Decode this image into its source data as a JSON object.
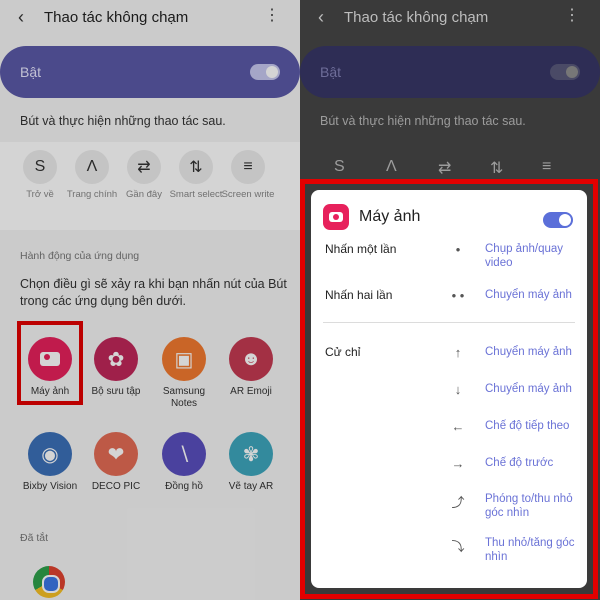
{
  "header": {
    "back_icon": "arrow-left-icon",
    "title": "Thao tác không chạm",
    "more_icon": "more-vert-icon"
  },
  "master_toggle": {
    "label": "Bật",
    "on": true
  },
  "instruction": "Bút và thực hiện những thao tác sau.",
  "gestures": [
    {
      "label": "Trở về",
      "icon": "gesture-back-icon"
    },
    {
      "label": "Trang chính",
      "icon": "gesture-home-icon"
    },
    {
      "label": "Gần đây",
      "icon": "gesture-recent-icon"
    },
    {
      "label": "Smart select",
      "icon": "gesture-smart-select-icon"
    },
    {
      "label": "Screen write",
      "icon": "gesture-screen-write-icon"
    }
  ],
  "app_actions": {
    "section_title": "Hành động của ứng dụng",
    "description": "Chọn điều gì sẽ xảy ra khi bạn nhấn nút của Bút trong các ứng dụng bên dưới.",
    "apps": [
      {
        "name": "Máy ảnh",
        "icon": "camera-icon",
        "color": "#e7215c"
      },
      {
        "name": "Bộ sưu tập",
        "icon": "gallery-icon",
        "color": "#c0275a"
      },
      {
        "name": "Samsung Notes",
        "icon": "notes-icon",
        "color": "#f27a2f"
      },
      {
        "name": "AR Emoji",
        "icon": "ar-emoji-icon",
        "color": "#c53a52"
      },
      {
        "name": "Bixby Vision",
        "icon": "bixby-vision-icon",
        "color": "#3c70b8"
      },
      {
        "name": "DECO PIC",
        "icon": "deco-pic-icon",
        "color": "#e46b55"
      },
      {
        "name": "Đồng hồ",
        "icon": "clock-icon",
        "color": "#5a4fbe"
      },
      {
        "name": "Vẽ tay AR",
        "icon": "ar-doodle-icon",
        "color": "#3ea6bd"
      }
    ],
    "disabled_section_title": "Đã tắt",
    "disabled_apps": [
      {
        "name": "Chrome",
        "icon": "chrome-icon"
      }
    ]
  },
  "camera_dialog": {
    "title": "Máy ảnh",
    "enabled": true,
    "press_actions": [
      {
        "trigger": "Nhấn một lần",
        "gesture": "•",
        "action": "Chụp ảnh/quay video"
      },
      {
        "trigger": "Nhấn hai lần",
        "gesture": "• •",
        "action": "Chuyển máy ảnh"
      }
    ],
    "gesture_label": "Cử chỉ",
    "gesture_actions": [
      {
        "gesture": "↑",
        "icon": "arrow-up-icon",
        "action": "Chuyển máy ảnh"
      },
      {
        "gesture": "↓",
        "icon": "arrow-down-icon",
        "action": "Chuyển máy ảnh"
      },
      {
        "gesture": "←",
        "icon": "arrow-left-icon",
        "action": "Chế độ tiếp theo"
      },
      {
        "gesture": "→",
        "icon": "arrow-right-icon",
        "action": "Chế độ trước"
      },
      {
        "gesture": "⤴",
        "icon": "circle-clockwise-icon",
        "action": "Phóng to/thu nhỏ góc nhìn"
      },
      {
        "gesture": "⤵",
        "icon": "circle-counterclockwise-icon",
        "action": "Thu nhỏ/tăng góc nhìn"
      }
    ]
  },
  "colors": {
    "accent": "#5b59a8",
    "highlight": "#e30000",
    "dialog_link": "#6a72d6"
  }
}
